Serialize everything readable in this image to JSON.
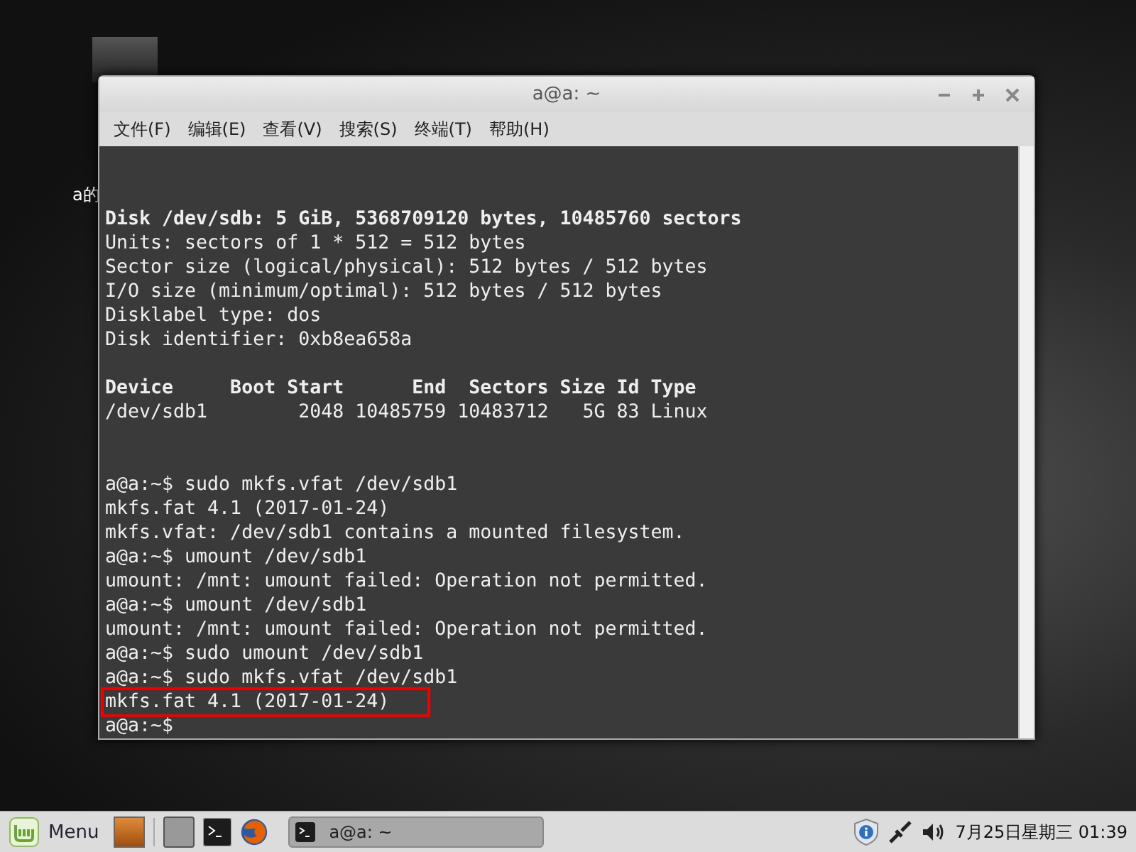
{
  "desktop": {
    "icons": [
      {
        "label": "a的"
      }
    ]
  },
  "window": {
    "title": "a@a: ~",
    "menu": [
      "文件(F)",
      "编辑(E)",
      "查看(V)",
      "搜索(S)",
      "终端(T)",
      "帮助(H)"
    ]
  },
  "terminal": {
    "lines": [
      {
        "kind": "blank"
      },
      {
        "kind": "blank"
      },
      {
        "kind": "bold",
        "text": "Disk /dev/sdb: 5 GiB, 5368709120 bytes, 10485760 sectors"
      },
      {
        "kind": "text",
        "text": "Units: sectors of 1 * 512 = 512 bytes"
      },
      {
        "kind": "text",
        "text": "Sector size (logical/physical): 512 bytes / 512 bytes"
      },
      {
        "kind": "text",
        "text": "I/O size (minimum/optimal): 512 bytes / 512 bytes"
      },
      {
        "kind": "text",
        "text": "Disklabel type: dos"
      },
      {
        "kind": "text",
        "text": "Disk identifier: 0xb8ea658a"
      },
      {
        "kind": "blank"
      },
      {
        "kind": "bold",
        "text": "Device     Boot Start      End  Sectors Size Id Type"
      },
      {
        "kind": "text",
        "text": "/dev/sdb1        2048 10485759 10483712   5G 83 Linux"
      },
      {
        "kind": "blank"
      },
      {
        "kind": "blank"
      },
      {
        "kind": "text",
        "text": "a@a:~$ sudo mkfs.vfat /dev/sdb1"
      },
      {
        "kind": "text",
        "text": "mkfs.fat 4.1 (2017-01-24)"
      },
      {
        "kind": "text",
        "text": "mkfs.vfat: /dev/sdb1 contains a mounted filesystem."
      },
      {
        "kind": "text",
        "text": "a@a:~$ umount /dev/sdb1"
      },
      {
        "kind": "text",
        "text": "umount: /mnt: umount failed: Operation not permitted."
      },
      {
        "kind": "text",
        "text": "a@a:~$ umount /dev/sdb1"
      },
      {
        "kind": "text",
        "text": "umount: /mnt: umount failed: Operation not permitted."
      },
      {
        "kind": "text",
        "text": "a@a:~$ sudo umount /dev/sdb1"
      },
      {
        "kind": "text",
        "text": "a@a:~$ sudo mkfs.vfat /dev/sdb1"
      },
      {
        "kind": "text",
        "text": "mkfs.fat 4.1 (2017-01-24)",
        "highlighted": true
      },
      {
        "kind": "text",
        "text": "a@a:~$"
      }
    ]
  },
  "taskbar": {
    "menu_label": "Menu",
    "tasks": [
      {
        "title": "a@a: ~",
        "selected": true
      }
    ],
    "clock": "7月25日星期三 01:39"
  }
}
